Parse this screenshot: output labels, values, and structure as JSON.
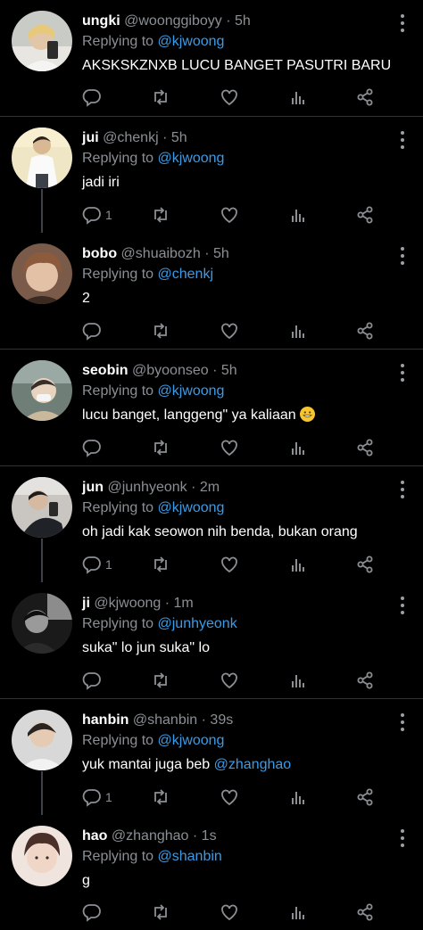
{
  "tweets": [
    {
      "name": "ungki",
      "handle": "@woonggiboyy",
      "sep": "·",
      "time": "5h",
      "replying": "Replying to",
      "to": "@kjwoong",
      "text": "AKSKSKZNXB LUCU BANGET PASUTRI BARU",
      "reply_count": ""
    },
    {
      "name": "jui",
      "handle": "@chenkj",
      "sep": "·",
      "time": "5h",
      "replying": "Replying to",
      "to": "@kjwoong",
      "text": "jadi iri",
      "reply_count": "1"
    },
    {
      "name": "bobo",
      "handle": "@shuaibozh",
      "sep": "·",
      "time": "5h",
      "replying": "Replying to",
      "to": "@chenkj",
      "text": "2",
      "reply_count": ""
    },
    {
      "name": "seobin",
      "handle": "@byoonseo",
      "sep": "·",
      "time": "5h",
      "replying": "Replying to",
      "to": "@kjwoong",
      "text": "lucu banget, langgeng\" ya kaliaan",
      "reply_count": ""
    },
    {
      "name": "jun",
      "handle": "@junhyeonk",
      "sep": "·",
      "time": "2m",
      "replying": "Replying to",
      "to": "@kjwoong",
      "text": "oh jadi kak seowon nih benda, bukan orang",
      "reply_count": "1"
    },
    {
      "name": "ji",
      "handle": "@kjwoong",
      "sep": "·",
      "time": "1m",
      "replying": "Replying to",
      "to": "@junhyeonk",
      "text": "suka\" lo jun suka\" lo",
      "reply_count": ""
    },
    {
      "name": "hanbin",
      "handle": "@shanbin",
      "sep": "·",
      "time": "39s",
      "replying": "Replying to",
      "to": "@kjwoong",
      "text": "yuk mantai juga beb ",
      "text_mention": "@zhanghao",
      "reply_count": "1"
    },
    {
      "name": "hao",
      "handle": "@zhanghao",
      "sep": "·",
      "time": "1s",
      "replying": "Replying to",
      "to": "@shanbin",
      "text": "g",
      "reply_count": ""
    }
  ],
  "icons": {
    "reply": "reply-icon",
    "retweet": "retweet-icon",
    "like": "heart-icon",
    "analytics": "analytics-icon",
    "share": "share-icon",
    "more": "more-vertical-icon",
    "emoji": "grinning-emoji-icon"
  },
  "colors": {
    "background": "#000000",
    "mention": "#3b9be6",
    "muted": "#8b8f94",
    "divider": "#2f3336"
  }
}
